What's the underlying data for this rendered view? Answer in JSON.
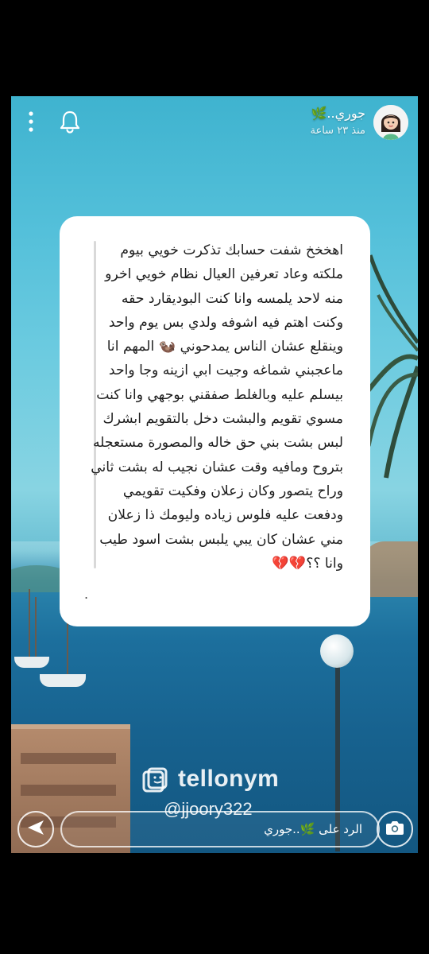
{
  "header": {
    "username": "جوري..🌿",
    "timestamp": "منذ ٢٣ ساعة"
  },
  "card": {
    "question": "اهخخخ شفت حسابك تذكرت خويي بيوم ملكته وعاد تعرفين العيال نظام خويي اخرو منه لاحد يلمسه وانا كنت البوديقارد حقه وكنت اهتم فيه اشوفه ولدي بس يوم واحد وينقلع عشان الناس يمدحوني 🦦 المهم انا ماعجبني شماغه وجيت ابي ازينه وجا واحد بيسلم عليه وبالغلط صفقني بوجهي وانا كنت مسوي تقويم والبشت دخل بالتقويم ابشرك لبس بشت بني حق خاله والمصورة مستعجله بتروح ومافيه وقت عشان نجيب له بشت ثاني وراح يتصور وكان زعلان وفكيت تقويمي ودفعت عليه فلوس زياده وليومك ذا زعلان مني عشان كان يبي يلبس بشت اسود طيب وانا ؟؟💔💔",
    "trailing_dot": "."
  },
  "watermark": {
    "brand": "tellonym",
    "handle": "@jjoory322"
  },
  "reply": {
    "label": "الرد على 🌿..جوري"
  },
  "icons": {
    "more": "more-vertical-icon",
    "bell": "bell-icon",
    "send": "send-arrow-icon",
    "camera": "camera-icon",
    "logo": "tellonym-logo-icon"
  },
  "colors": {
    "card": "#ffffff",
    "quote_bar": "#d9d9d9",
    "text": "#1d1d1d"
  }
}
